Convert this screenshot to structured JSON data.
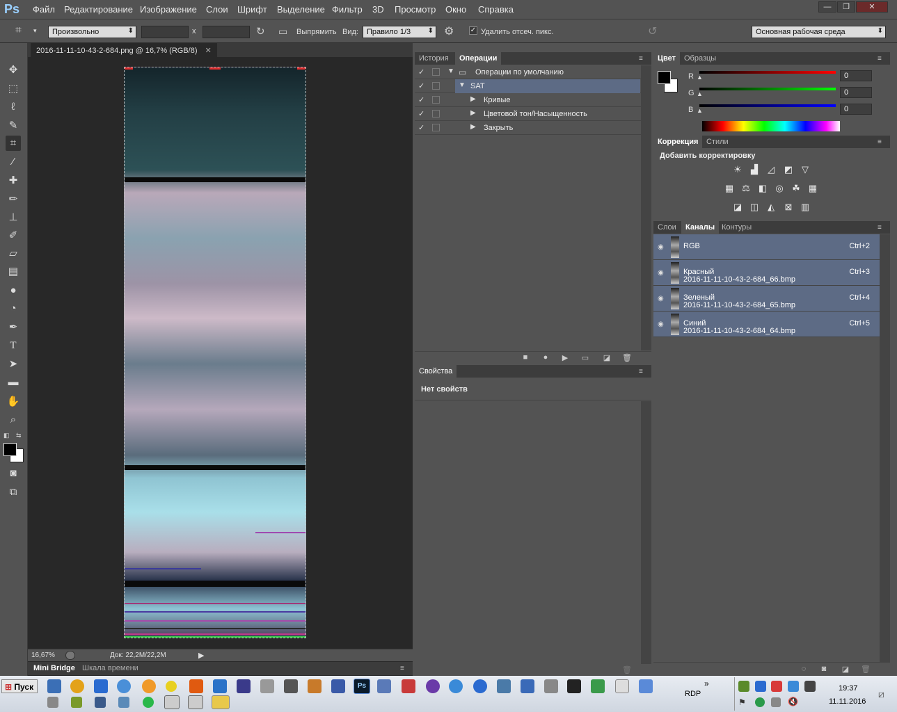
{
  "menubar": {
    "logo": "Ps",
    "items": [
      "Файл",
      "Редактирование",
      "Изображение",
      "Слои",
      "Шрифт",
      "Выделение",
      "Фильтр",
      "3D",
      "Просмотр",
      "Окно",
      "Справка"
    ]
  },
  "window": {
    "minimize": "—",
    "restore": "❐",
    "close": "✕"
  },
  "options": {
    "ratio": "Произвольно",
    "x_sep": "x",
    "straighten": "Выпрямить",
    "view_label": "Вид:",
    "view_value": "Правило 1/3",
    "delete_cropped": "Удалить отсеч. пикс.",
    "workspace": "Основная рабочая среда"
  },
  "document": {
    "tab": "2016-11-11-10-43-2-684.png @ 16,7% (RGB/8)",
    "tab_close": "✕",
    "zoom": "16,67%",
    "doc_info": "Док: 22,2M/22,2M"
  },
  "bottom_tabs": {
    "bridge": "Mini Bridge",
    "timeline": "Шкала времени"
  },
  "actions_panel": {
    "tabs": [
      "История",
      "Операции"
    ],
    "active_tab": "Операции",
    "rows": [
      {
        "label": "Операции по умолчанию",
        "level": 0
      },
      {
        "label": "SAT",
        "level": 1
      },
      {
        "label": "Кривые",
        "level": 2
      },
      {
        "label": "Цветовой тон/Насыщенность",
        "level": 2
      },
      {
        "label": "Закрыть",
        "level": 2
      }
    ]
  },
  "properties_panel": {
    "tab": "Свойства",
    "empty": "Нет свойств"
  },
  "color_panel": {
    "tabs": [
      "Цвет",
      "Образцы"
    ],
    "r_label": "R",
    "g_label": "G",
    "b_label": "B",
    "r": "0",
    "g": "0",
    "b": "0"
  },
  "adjustments_panel": {
    "tabs": [
      "Коррекция",
      "Стили"
    ],
    "title": "Добавить корректировку"
  },
  "channels_panel": {
    "tabs": [
      "Слои",
      "Каналы",
      "Контуры"
    ],
    "active_tab": "Каналы",
    "channels": [
      {
        "name": "RGB",
        "file": "",
        "shortcut": "Ctrl+2"
      },
      {
        "name": "Красный",
        "file": "2016-11-11-10-43-2-684_66.bmp",
        "shortcut": "Ctrl+3"
      },
      {
        "name": "Зеленый",
        "file": "2016-11-11-10-43-2-684_65.bmp",
        "shortcut": "Ctrl+4"
      },
      {
        "name": "Синий",
        "file": "2016-11-11-10-43-2-684_64.bmp",
        "shortcut": "Ctrl+5"
      }
    ]
  },
  "taskbar": {
    "start": "Пуск",
    "rdp": "RDP",
    "more": "»",
    "time": "19:37",
    "date": "11.11.2016"
  }
}
